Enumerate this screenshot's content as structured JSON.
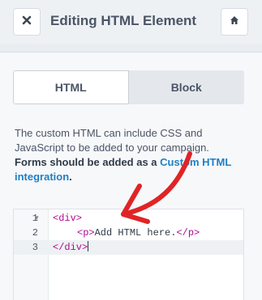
{
  "header": {
    "title": "Editing HTML Element",
    "close_icon": "close-icon",
    "home_icon": "home-icon"
  },
  "tabs": [
    {
      "label": "HTML",
      "active": true
    },
    {
      "label": "Block",
      "active": false
    }
  ],
  "description": {
    "line1": "The custom HTML can include CSS and",
    "line2": "JavaScript to be added to your campaign.",
    "bold": "Forms should be added as a",
    "link": "Custom HTML integration",
    "end": "."
  },
  "editor": {
    "lines": [
      {
        "num": "1",
        "open": "<div>",
        "text": "",
        "close": ""
      },
      {
        "num": "2",
        "open": "<p>",
        "text": "Add HTML here.",
        "close": "</p>"
      },
      {
        "num": "3",
        "open": "</div>",
        "text": "",
        "close": ""
      }
    ]
  },
  "colors": {
    "accent_link": "#1f7fc4",
    "annotation_arrow": "#e02426",
    "tag": "#b00a91"
  }
}
